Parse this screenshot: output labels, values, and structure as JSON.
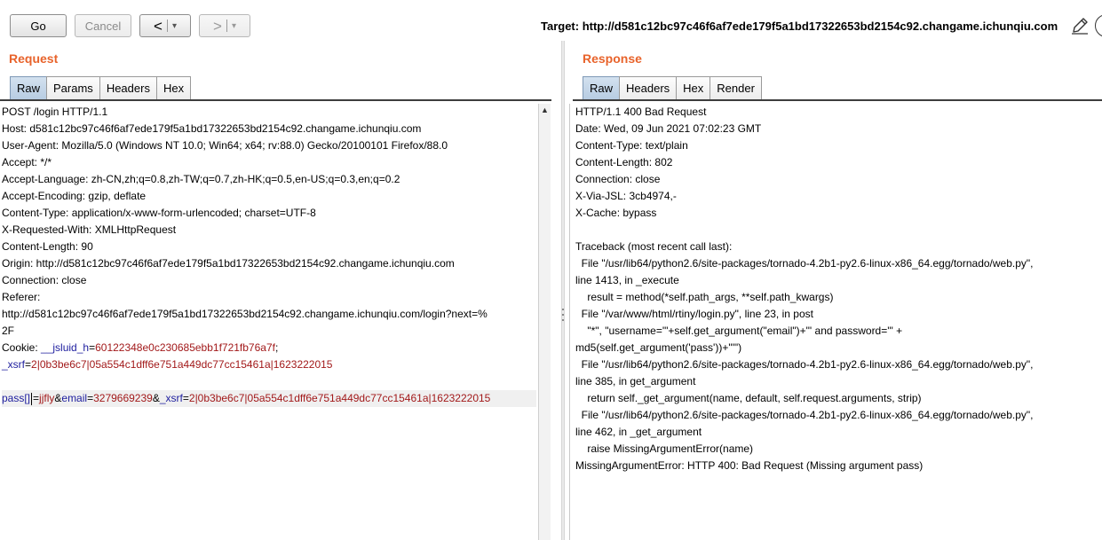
{
  "toolbar": {
    "go_label": "Go",
    "cancel_label": "Cancel",
    "back_label": "<",
    "forward_label": ">",
    "dropdown_glyph": "▾",
    "target_label": "Target: http://d581c12bc97c46f6af7ede179f5a1bd17322653bd2154c92.changame.ichunqiu.com"
  },
  "request": {
    "title": "Request",
    "tabs": [
      {
        "label": "Raw",
        "active": true
      },
      {
        "label": "Params"
      },
      {
        "label": "Headers"
      },
      {
        "label": "Hex"
      }
    ],
    "lines": [
      "POST /login HTTP/1.1",
      "Host: d581c12bc97c46f6af7ede179f5a1bd17322653bd2154c92.changame.ichunqiu.com",
      "User-Agent: Mozilla/5.0 (Windows NT 10.0; Win64; x64; rv:88.0) Gecko/20100101 Firefox/88.0",
      "Accept: */*",
      "Accept-Language: zh-CN,zh;q=0.8,zh-TW;q=0.7,zh-HK;q=0.5,en-US;q=0.3,en;q=0.2",
      "Accept-Encoding: gzip, deflate",
      "Content-Type: application/x-www-form-urlencoded; charset=UTF-8",
      "X-Requested-With: XMLHttpRequest",
      "Content-Length: 90",
      "Origin: http://d581c12bc97c46f6af7ede179f5a1bd17322653bd2154c92.changame.ichunqiu.com",
      "Connection: close",
      "Referer:",
      "http://d581c12bc97c46f6af7ede179f5a1bd17322653bd2154c92.changame.ichunqiu.com/login?next=%",
      "2F"
    ],
    "cookie": {
      "prefix": "Cookie: ",
      "jsluid_key": "__jsluid_h",
      "jsluid_val": "60122348e0c230685ebb1f721fb76a7f",
      "xsrf_key": "_xsrf",
      "xsrf_val": "2|0b3be6c7|05a554c1dff6e751a449dc77cc15461a|1623222015"
    },
    "body": {
      "k1": "pass[]",
      "v1": "jjfly",
      "k2": "email",
      "v2": "3279669239",
      "k3": "_xsrf",
      "v3": "2|0b3be6c7|05a554c1dff6e751a449dc77cc15461a|1623222015"
    }
  },
  "response": {
    "title": "Response",
    "tabs": [
      {
        "label": "Raw",
        "active": true
      },
      {
        "label": "Headers"
      },
      {
        "label": "Hex"
      },
      {
        "label": "Render"
      }
    ],
    "lines": [
      "HTTP/1.1 400 Bad Request",
      "Date: Wed, 09 Jun 2021 07:02:23 GMT",
      "Content-Type: text/plain",
      "Content-Length: 802",
      "Connection: close",
      "X-Via-JSL: 3cb4974,-",
      "X-Cache: bypass",
      "",
      "Traceback (most recent call last):",
      "  File \"/usr/lib64/python2.6/site-packages/tornado-4.2b1-py2.6-linux-x86_64.egg/tornado/web.py\",",
      "line 1413, in _execute",
      "    result = method(*self.path_args, **self.path_kwargs)",
      "  File \"/var/www/html/rtiny/login.py\", line 23, in post",
      "    \"*\", \"username='\"+self.get_argument(\"email\")+\"' and password='\" +",
      "md5(self.get_argument('pass'))+\"'\")",
      "  File \"/usr/lib64/python2.6/site-packages/tornado-4.2b1-py2.6-linux-x86_64.egg/tornado/web.py\",",
      "line 385, in get_argument",
      "    return self._get_argument(name, default, self.request.arguments, strip)",
      "  File \"/usr/lib64/python2.6/site-packages/tornado-4.2b1-py2.6-linux-x86_64.egg/tornado/web.py\",",
      "line 462, in _get_argument",
      "    raise MissingArgumentError(name)",
      "MissingArgumentError: HTTP 400: Bad Request (Missing argument pass)"
    ]
  }
}
